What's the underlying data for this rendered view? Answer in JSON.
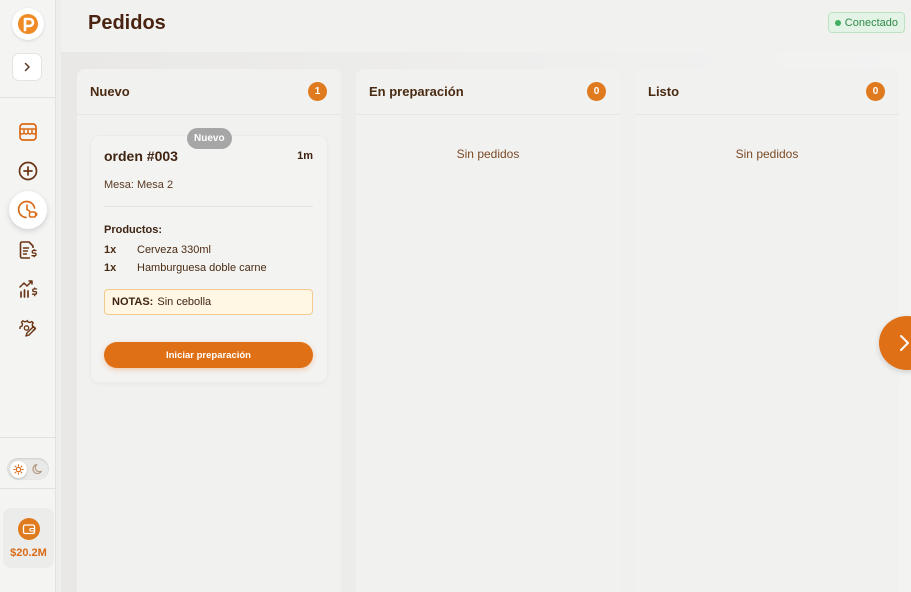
{
  "header": {
    "title": "Pedidos",
    "connection_status": "Conectado"
  },
  "sidebar": {
    "items": [
      {
        "icon": "store-icon"
      },
      {
        "icon": "plus-circle-icon"
      },
      {
        "icon": "clock-cup-icon",
        "active": true
      },
      {
        "icon": "invoice-dollar-icon"
      },
      {
        "icon": "chart-dollar-icon"
      },
      {
        "icon": "gear-pen-icon"
      }
    ],
    "wallet_amount": "$20.2M"
  },
  "columns": [
    {
      "title": "Nuevo",
      "count": "1"
    },
    {
      "title": "En preparación",
      "count": "0",
      "empty_text": "Sin pedidos"
    },
    {
      "title": "Listo",
      "count": "0",
      "empty_text": "Sin pedidos"
    }
  ],
  "order": {
    "badge": "Nuevo",
    "title": "orden #003",
    "time": "1m",
    "mesa": "Mesa: Mesa 2",
    "products_label": "Productos:",
    "products": [
      {
        "qty": "1x",
        "name": "Cerveza 330ml"
      },
      {
        "qty": "1x",
        "name": "Hamburguesa doble carne"
      }
    ],
    "notes_label": "NOTAS:",
    "notes_text": "Sin cebolla",
    "action_label": "Iniciar preparación"
  },
  "colors": {
    "accent": "#e07015",
    "connected": "#3fae5e"
  }
}
